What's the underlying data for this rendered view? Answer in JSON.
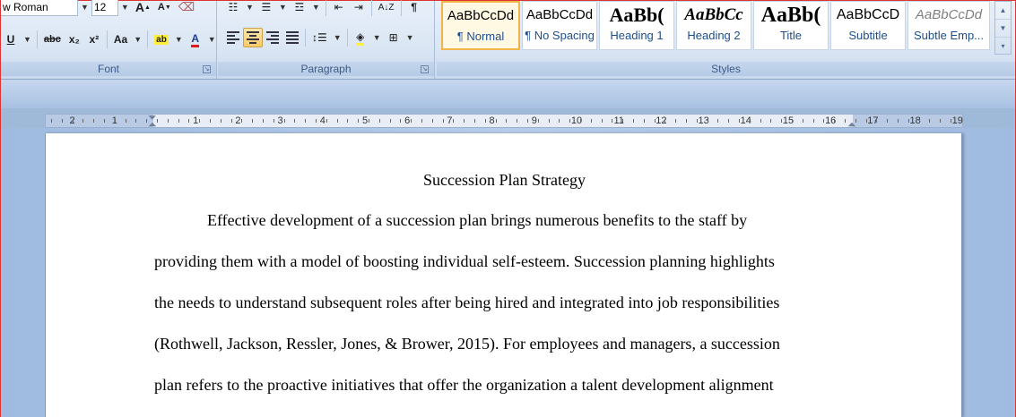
{
  "ribbon": {
    "font": {
      "font_name": "w Roman",
      "font_size": "12",
      "grow_label": "A",
      "shrink_label": "A",
      "underline_label": "U",
      "strikethrough_label": "abc",
      "subscript_label": "x₂",
      "superscript_label": "x²",
      "change_case_label": "Aa",
      "highlight_label": "ab",
      "font_color_label": "A",
      "group_label": "Font"
    },
    "paragraph": {
      "group_label": "Paragraph"
    },
    "styles": {
      "group_label": "Styles",
      "items": [
        {
          "sample": "AaBbCcDd",
          "name": "¶ Normal"
        },
        {
          "sample": "AaBbCcDd",
          "name": "¶ No Spacing"
        },
        {
          "sample": "AaBb(",
          "name": "Heading 1"
        },
        {
          "sample": "AaBbCc",
          "name": "Heading 2"
        },
        {
          "sample": "AaBb(",
          "name": "Title"
        },
        {
          "sample": "AaBbCcD",
          "name": "Subtitle"
        },
        {
          "sample": "AaBbCcDd",
          "name": "Subtle Emp..."
        }
      ]
    }
  },
  "ruler": {
    "left_labels": [
      "2",
      "1"
    ],
    "right_labels": [
      "1",
      "2",
      "3",
      "4",
      "5",
      "6",
      "7",
      "8",
      "9",
      "10",
      "11",
      "12",
      "13",
      "14",
      "15",
      "16",
      "17",
      "18",
      "19"
    ]
  },
  "document": {
    "title": "Succession Plan Strategy",
    "lines": [
      "Effective development of a succession plan brings numerous benefits to the staff by",
      "providing them with a model of boosting individual self-esteem. Succession planning highlights",
      "the needs to understand subsequent roles after being hired and integrated into job responsibilities",
      "(Rothwell, Jackson, Ressler, Jones, & Brower, 2015). For employees and managers, a succession",
      "plan refers to the proactive initiatives that offer the organization a talent development alignment"
    ]
  },
  "colors": {
    "highlight": "#ffef3a",
    "font_color": "#e01c1c",
    "selected_style_border": "#f0b44a",
    "style_name": "#1e4e8c"
  }
}
